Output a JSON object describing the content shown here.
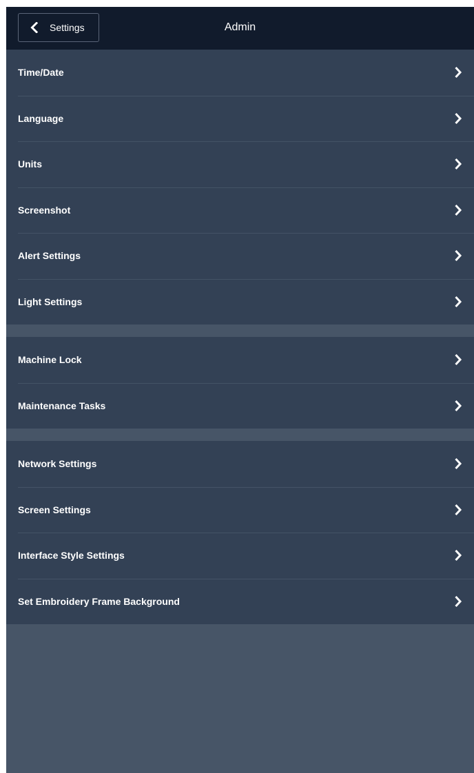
{
  "header": {
    "back_label": "Settings",
    "back_icon": "chevron-left-icon",
    "title": "Admin"
  },
  "groups": [
    {
      "items": [
        {
          "label": "Time/Date",
          "icon": "chevron-right-icon"
        },
        {
          "label": "Language",
          "icon": "chevron-right-icon"
        },
        {
          "label": "Units",
          "icon": "chevron-right-icon"
        },
        {
          "label": "Screenshot",
          "icon": "chevron-right-icon"
        },
        {
          "label": "Alert Settings",
          "icon": "chevron-right-icon"
        },
        {
          "label": "Light Settings",
          "icon": "chevron-right-icon"
        }
      ]
    },
    {
      "items": [
        {
          "label": "Machine Lock",
          "icon": "chevron-right-icon"
        },
        {
          "label": "Maintenance Tasks",
          "icon": "chevron-right-icon"
        }
      ]
    },
    {
      "items": [
        {
          "label": "Network Settings",
          "icon": "chevron-right-icon"
        },
        {
          "label": "Screen Settings",
          "icon": "chevron-right-icon"
        },
        {
          "label": "Interface Style Settings",
          "icon": "chevron-right-icon"
        },
        {
          "label": "Set Embroidery Frame Background",
          "icon": "chevron-right-icon"
        }
      ]
    }
  ],
  "colors": {
    "header_bg": "#111b2c",
    "row_bg": "#334155",
    "page_bg": "#475567",
    "text": "#ffffff"
  }
}
